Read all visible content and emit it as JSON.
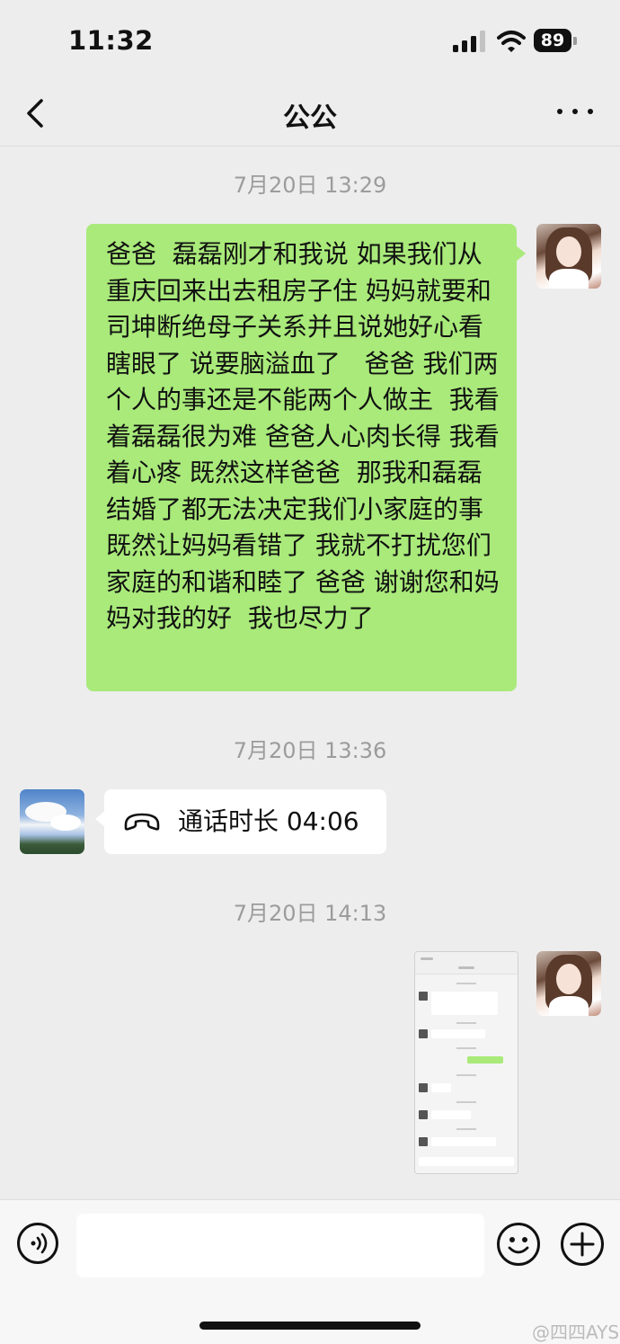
{
  "status_bar": {
    "time": "11:32",
    "battery": "89",
    "signal_icon": "cellular-signal-icon",
    "wifi_icon": "wifi-icon"
  },
  "nav": {
    "title": "公公",
    "back_icon": "chevron-left-icon",
    "more_icon": "more-dots-icon"
  },
  "messages": [
    {
      "type": "timestamp",
      "text": "7月20日 13:29"
    },
    {
      "type": "text",
      "sender": "self",
      "text": "爸爸  磊磊刚才和我说 如果我们从重庆回来出去租房子住 妈妈就要和司坤断绝母子关系并且说她好心看瞎眼了 说要脑溢血了   爸爸 我们两个人的事还是不能两个人做主  我看着磊磊很为难 爸爸人心肉长得 我看着心疼 既然这样爸爸  那我和磊磊结婚了都无法决定我们小家庭的事  既然让妈妈看错了 我就不打扰您们家庭的和谐和睦了 爸爸 谢谢您和妈妈对我的好  我也尽力了"
    },
    {
      "type": "timestamp",
      "text": "7月20日 13:36"
    },
    {
      "type": "call",
      "sender": "other",
      "text": "通话时长 04:06",
      "icon": "phone-hangup-icon"
    },
    {
      "type": "timestamp",
      "text": "7月20日 14:13"
    },
    {
      "type": "image",
      "sender": "self",
      "description_icon": "screenshot-thumbnail"
    }
  ],
  "input_bar": {
    "voice_icon": "voice-icon",
    "placeholder": "",
    "emoji_icon": "emoji-icon",
    "plus_icon": "plus-icon"
  },
  "watermark": "@四四AYS",
  "colors": {
    "background": "#ededed",
    "bubble_self": "#a9ea7a",
    "bubble_other": "#ffffff",
    "timestamp": "#9c9c9c"
  }
}
